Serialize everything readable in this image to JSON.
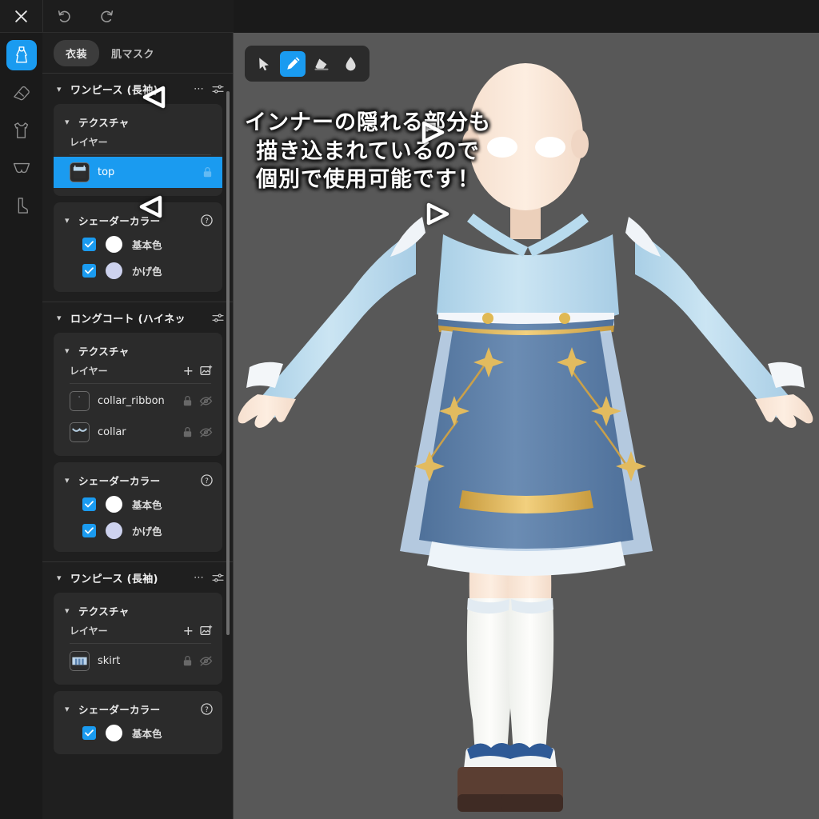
{
  "topbar": {
    "close_icon": "close-icon",
    "undo_icon": "undo-icon",
    "redo_icon": "redo-icon"
  },
  "rail": {
    "items": [
      {
        "icon": "dress-icon",
        "name": "category-dress",
        "active": true
      },
      {
        "icon": "shoe-icon",
        "name": "category-shoes",
        "active": false
      },
      {
        "icon": "tanktop-icon",
        "name": "category-tops",
        "active": false
      },
      {
        "icon": "underwear-icon",
        "name": "category-innerwear",
        "active": false
      },
      {
        "icon": "boot-icon",
        "name": "category-boots",
        "active": false
      }
    ]
  },
  "sidebar": {
    "tabs": [
      {
        "label": "衣装",
        "active": true
      },
      {
        "label": "肌マスク",
        "active": false
      }
    ],
    "groups": [
      {
        "title": "ワンピース (長袖)",
        "texture_label": "テクスチャ",
        "layers_label": "レイヤー",
        "layers": [
          {
            "name": "top",
            "selected": true,
            "locked": true,
            "hidden": true,
            "thumb": "top-thumb"
          }
        ],
        "shader_label": "シェーダーカラー",
        "colors": [
          {
            "label": "基本色",
            "checked": true,
            "hex": "#ffffff"
          },
          {
            "label": "かげ色",
            "checked": true,
            "hex": "#cdd2ee"
          }
        ]
      },
      {
        "title": "ロングコート (ハイネッ",
        "texture_label": "テクスチャ",
        "layers_label": "レイヤー",
        "layers": [
          {
            "name": "collar_ribbon",
            "selected": false,
            "locked": true,
            "hidden": true,
            "thumb": "ribbon-thumb"
          },
          {
            "name": "collar",
            "selected": false,
            "locked": true,
            "hidden": true,
            "thumb": "collar-thumb"
          }
        ],
        "shader_label": "シェーダーカラー",
        "colors": [
          {
            "label": "基本色",
            "checked": true,
            "hex": "#ffffff"
          },
          {
            "label": "かげ色",
            "checked": true,
            "hex": "#cdd2ee"
          }
        ]
      },
      {
        "title": "ワンピース (長袖)",
        "texture_label": "テクスチャ",
        "layers_label": "レイヤー",
        "layers": [
          {
            "name": "skirt",
            "selected": false,
            "locked": true,
            "hidden": true,
            "thumb": "skirt-thumb"
          }
        ],
        "shader_label": "シェーダーカラー",
        "colors": [
          {
            "label": "基本色",
            "checked": true,
            "hex": "#ffffff"
          }
        ]
      }
    ]
  },
  "viewport": {
    "background_hex": "#585858",
    "tools": [
      {
        "icon": "cursor-icon",
        "name": "select-tool",
        "active": false
      },
      {
        "icon": "pencil-icon",
        "name": "pencil-tool",
        "active": true
      },
      {
        "icon": "eraser-icon",
        "name": "eraser-tool",
        "active": false
      },
      {
        "icon": "droplet-icon",
        "name": "blur-tool",
        "active": false
      }
    ],
    "caption_lines": [
      "インナーの隠れる部分も",
      "描き込まれているので",
      "個別で使用可能です！"
    ]
  },
  "theme": {
    "accent_hex": "#1a9bf0",
    "panel_hex": "#1f1f1f",
    "card_hex": "#2b2b2b",
    "text_hex": "#e9e9e9"
  }
}
